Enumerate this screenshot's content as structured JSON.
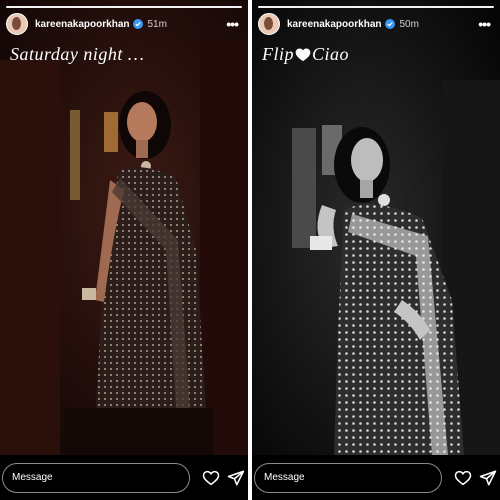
{
  "left_story": {
    "username": "kareenakapoorkhan",
    "time": "51m",
    "caption": "Saturday night …",
    "message_placeholder": "Message",
    "icons": [
      "verified-badge-icon",
      "more-options-icon",
      "heart-icon",
      "send-icon"
    ]
  },
  "right_story": {
    "username": "kareenakapoorkhan",
    "time": "50m",
    "caption_before": "Flip",
    "caption_after": "Ciao",
    "message_placeholder": "Message",
    "icons": [
      "verified-badge-icon",
      "more-options-icon",
      "white-heart-emoji-icon",
      "heart-icon",
      "send-icon"
    ]
  },
  "colors": {
    "accent_verified": "#3897f0",
    "background": "#000000",
    "divider": "#ffffff"
  }
}
